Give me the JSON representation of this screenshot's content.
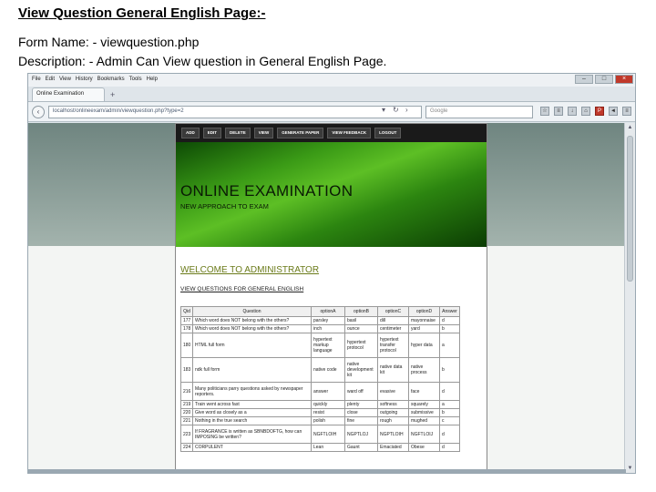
{
  "slide": {
    "title": "View Question General English Page:-",
    "form_line": "Form Name: - viewquestion.php",
    "description_line": "Description: - Admin Can View question in General English Page."
  },
  "browser": {
    "menu": [
      "File",
      "Edit",
      "View",
      "History",
      "Bookmarks",
      "Tools",
      "Help"
    ],
    "tab_title": "Online Examination",
    "new_tab": "+",
    "url": "localhost/onlineexam/admin/viewquestion.php?type=2",
    "search_placeholder": "Google",
    "icons": {
      "back": "back-arrow-icon",
      "search": "magnifier-icon",
      "home": "home-icon",
      "bookmark": "star-icon"
    }
  },
  "site": {
    "nav": [
      "ADD",
      "EDIT",
      "DELETE",
      "VIEW",
      "GENERATE PAPER",
      "VIEW FEEDBACK",
      "LOGOUT"
    ],
    "banner_title": "ONLINE EXAMINATION",
    "banner_subtitle": "NEW APPROACH TO EXAM",
    "welcome": "WELCOME TO ADMINISTRATOR",
    "section_heading": "VIEW QUESTIONS FOR GENERAL ENGLISH",
    "colors": {
      "nav_bg": "#1a1a1a",
      "banner_green": "#3a9a16",
      "welcome_text": "#6b7b1a"
    }
  },
  "table": {
    "headers": [
      "Qid",
      "Question",
      "optionA",
      "optionB",
      "optionC",
      "optionD",
      "Answer"
    ],
    "rows": [
      {
        "qid": "177",
        "question": "Which word does NOT belong with the others?",
        "a": "parsley",
        "b": "basil",
        "c": "dill",
        "d": "mayonnaise",
        "ans": "d"
      },
      {
        "qid": "178",
        "question": "Which word does NOT belong with the others?",
        "a": "inch",
        "b": "ounce",
        "c": "centimeter",
        "d": "yard",
        "ans": "b"
      },
      {
        "qid": "180",
        "question": "HTML full form",
        "a": "hypertext markup language",
        "b": "hypertext protocol",
        "c": "hypertext transfer protocol",
        "d": "hyper data",
        "ans": "a"
      },
      {
        "qid": "183",
        "question": "ndk full form",
        "a": "native code",
        "b": "native development kit",
        "c": "native data kit",
        "d": "native process",
        "ans": "b"
      },
      {
        "qid": "216",
        "question": "Many politicians parry questions asked by newspaper reporters.",
        "a": "answer",
        "b": "ward off",
        "c": "evasive",
        "d": "face",
        "ans": "d"
      },
      {
        "qid": "219",
        "question": "Train went across fast",
        "a": "quickly",
        "b": "plenty",
        "c": "softness",
        "d": "squarely",
        "ans": "a"
      },
      {
        "qid": "220",
        "question": "Give word as closely as a",
        "a": "resist",
        "b": "close",
        "c": "outgoing",
        "d": "submissive",
        "ans": "b"
      },
      {
        "qid": "221",
        "question": "Nothing in the true search",
        "a": "polish",
        "b": "fine",
        "c": "rough",
        "d": "mughed",
        "ans": "c"
      },
      {
        "qid": "223",
        "question": "If FRAGRANCE is written as SBNBDOFTG, how can IMPOSING be written?",
        "a": "NGFTLOIH",
        "b": "NGPTLOJ",
        "c": "NGPTLOIH",
        "d": "NGFTLOIJ",
        "ans": "d"
      },
      {
        "qid": "224",
        "question": "CORPULENT",
        "a": "Lean",
        "b": "Gaunt",
        "c": "Emaciated",
        "d": "Obese",
        "ans": "d"
      }
    ]
  }
}
